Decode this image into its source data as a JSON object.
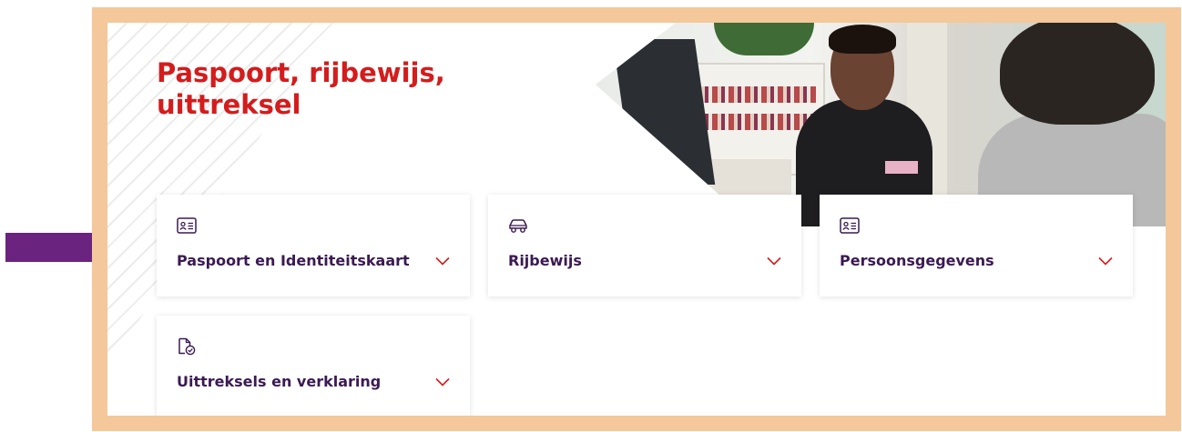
{
  "page": {
    "title": "Paspoort, rijbewijs, uittreksel",
    "colors": {
      "frame_border": "#f4c89a",
      "title": "#d41c1c",
      "tile_label": "#3b1a52",
      "chevron": "#d41c1c",
      "arrow": "#6a2480"
    }
  },
  "tiles": [
    {
      "label": "Paspoort en Identiteitskaart",
      "icon": "id-card-icon"
    },
    {
      "label": "Rijbewijs",
      "icon": "car-icon"
    },
    {
      "label": "Persoonsgegevens",
      "icon": "id-card-icon"
    },
    {
      "label": "Uittreksels en verklaring",
      "icon": "document-check-icon"
    }
  ],
  "annotation": {
    "arrow_points_to": "Paspoort en Identiteitskaart"
  }
}
